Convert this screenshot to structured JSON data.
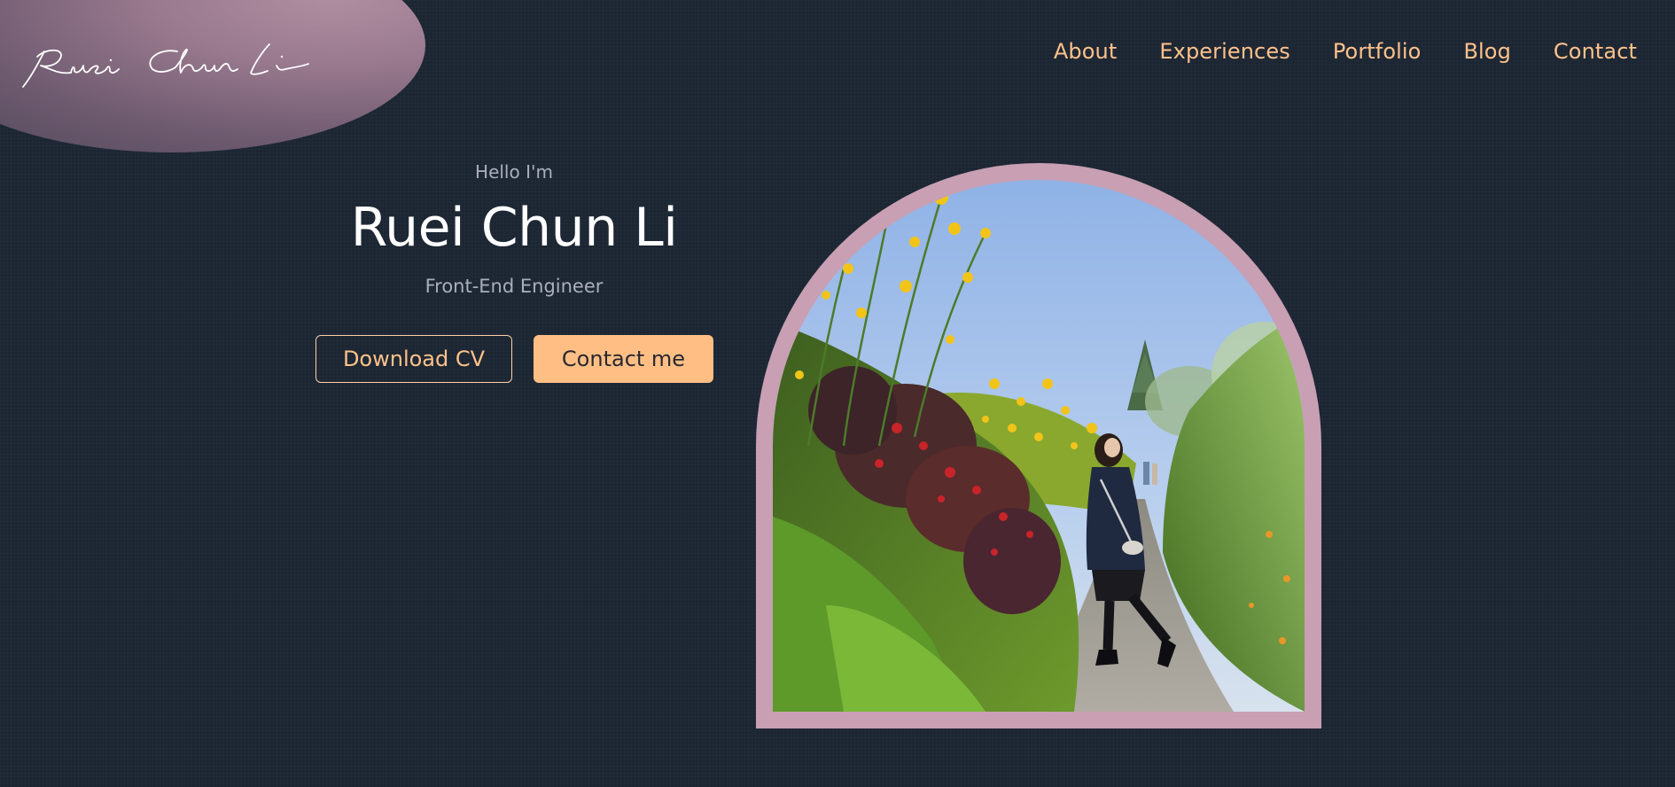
{
  "logo": {
    "text": "Ruei Chun Li",
    "icon": "signature-logo"
  },
  "nav": {
    "items": [
      {
        "label": "About"
      },
      {
        "label": "Experiences"
      },
      {
        "label": "Portfolio"
      },
      {
        "label": "Blog"
      },
      {
        "label": "Contact"
      }
    ]
  },
  "hero": {
    "greeting": "Hello I'm",
    "name": "Ruei Chun Li",
    "role": "Front-End Engineer",
    "download_cv_label": "Download CV",
    "contact_label": "Contact me"
  },
  "colors": {
    "background": "#1c2633",
    "accent": "#ffbf84",
    "nav_text": "#ffc28a",
    "frame": "#c89fb3",
    "muted_text": "#a9afb9"
  }
}
